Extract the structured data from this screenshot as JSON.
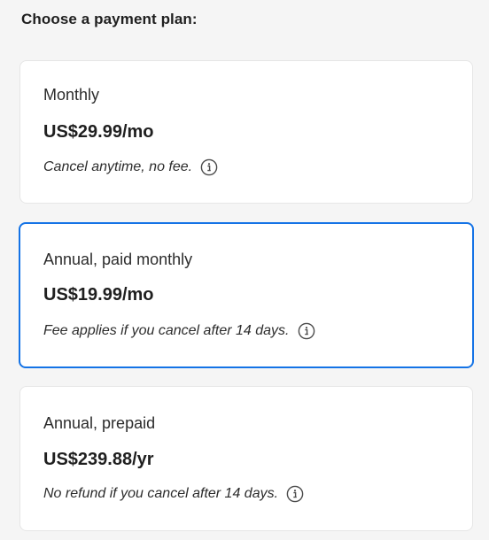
{
  "heading": "Choose a payment plan:",
  "accent_color": "#1473e6",
  "plans": [
    {
      "name": "Monthly",
      "price": "US$29.99/mo",
      "note": "Cancel anytime, no fee.",
      "icon": "info-icon",
      "selected": false
    },
    {
      "name": "Annual, paid monthly",
      "price": "US$19.99/mo",
      "note": "Fee applies if you cancel after 14 days.",
      "icon": "info-icon",
      "selected": true
    },
    {
      "name": "Annual, prepaid",
      "price": "US$239.88/yr",
      "note": "No refund if you cancel after 14 days.",
      "icon": "info-icon",
      "selected": false
    }
  ]
}
